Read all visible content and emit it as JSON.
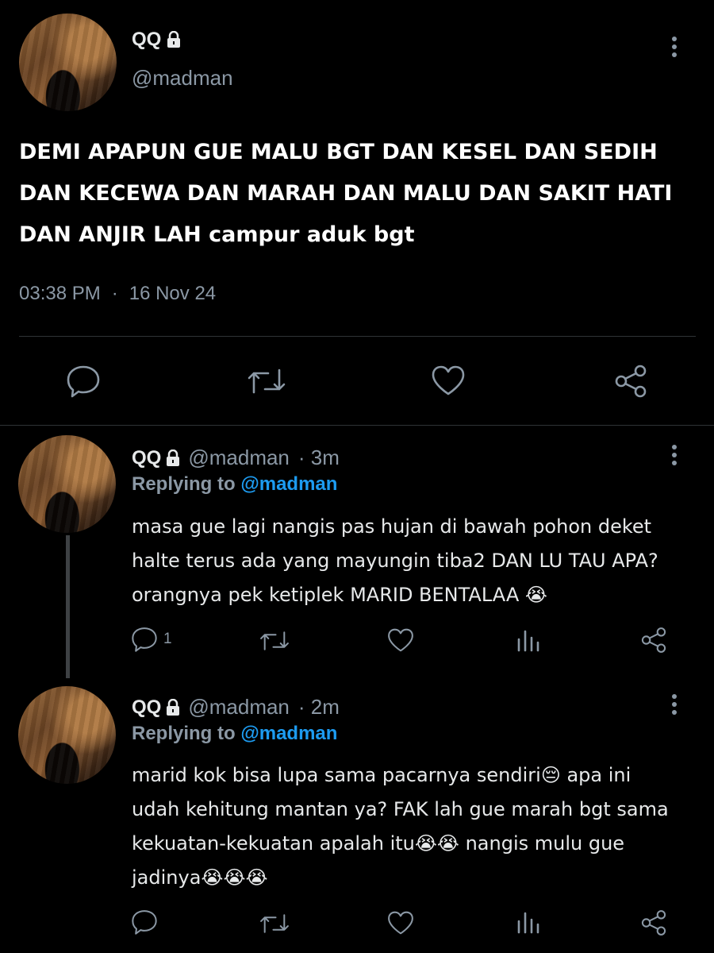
{
  "main_tweet": {
    "display_name": "QQ",
    "handle": "@madman",
    "text_lines": [
      "DEMI APAPUN GUE MALU BGT DAN KESEL DAN SEDIH",
      "DAN KECEWA DAN MARAH DAN MALU DAN SAKIT HATI",
      "DAN ANJIR LAH campur aduk bgt"
    ],
    "time": "03:38 PM",
    "separator": "·",
    "date": "16 Nov 24"
  },
  "replies": [
    {
      "display_name": "QQ",
      "handle": "@madman",
      "age": "· 3m",
      "replying_prefix": "Replying to",
      "replying_handle": "@madman",
      "text_lines": [
        "masa gue lagi nangis pas hujan di bawah pohon deket",
        "halte terus ada yang mayungin tiba2 DAN LU TAU APA?",
        "orangnya pek ketiplek MARID BENTALAA 😭"
      ],
      "reply_count": "1"
    },
    {
      "display_name": "QQ",
      "handle": "@madman",
      "age": "· 2m",
      "replying_prefix": "Replying to",
      "replying_handle": "@madman",
      "text_lines": [
        "marid kok bisa lupa sama pacarnya sendiri😔 apa ini",
        "udah kehitung mantan ya? FAK lah gue marah bgt sama",
        "kekuatan-kekuatan apalah itu😭😭 nangis mulu gue",
        "jadinya😭😭😭"
      ],
      "reply_count": ""
    }
  ],
  "colors": {
    "background": "#000000",
    "text": "#e7e9ea",
    "muted": "#8b98a5",
    "link": "#1d9bf0"
  },
  "icons": [
    "lock-icon",
    "more-icon",
    "reply-icon",
    "retweet-icon",
    "like-icon",
    "share-icon",
    "analytics-icon"
  ]
}
